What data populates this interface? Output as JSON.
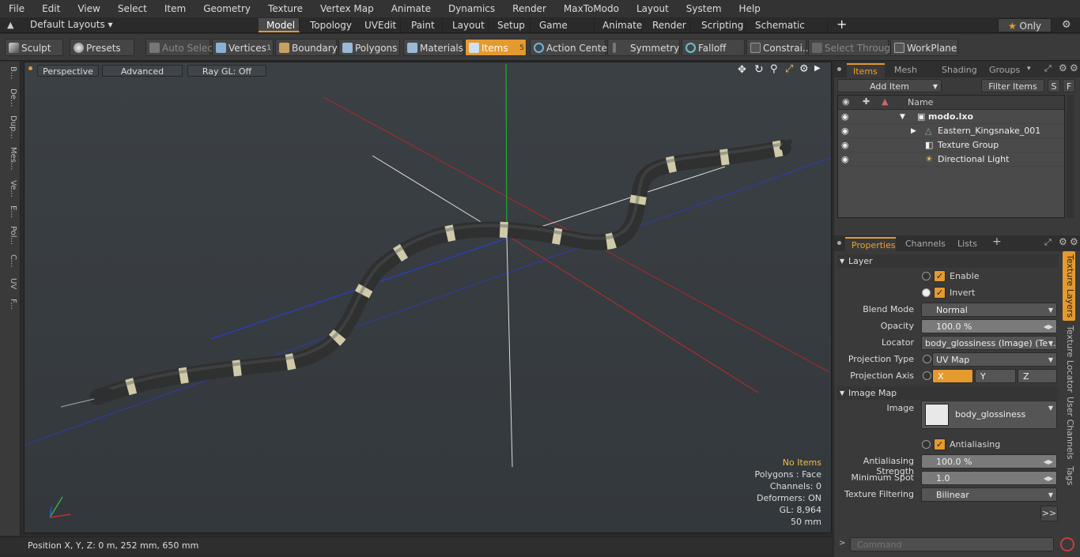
{
  "menu": [
    "File",
    "Edit",
    "View",
    "Select",
    "Item",
    "Geometry",
    "Texture",
    "Vertex Map",
    "Animate",
    "Dynamics",
    "Render",
    "MaxToModo",
    "Layout",
    "System",
    "Help"
  ],
  "layout": {
    "layout_label": "Default Layouts",
    "tabs": [
      "Model",
      "Topology",
      "UVEdit",
      "Paint",
      "Layout",
      "Setup",
      "Game Tools",
      "Animate",
      "Render",
      "Scripting",
      "Schematic Fusion"
    ],
    "active_tab": "Model",
    "add": "+",
    "only_label": "Only"
  },
  "toolbar": {
    "sculpt": "Sculpt",
    "presets": "Presets",
    "auto_select": "Auto Select",
    "vertices": "Vertices",
    "vertices_count": "1",
    "boundary": "Boundary",
    "polygons": "Polygons",
    "materials": "Materials",
    "items": "Items",
    "items_count": "5",
    "action_center": "Action Center",
    "symmetry": "Symmetry",
    "falloff": "Falloff",
    "constraints": "Constrai...",
    "select_through": "Select Through",
    "workplane": "WorkPlane"
  },
  "leftstrip": [
    "B...",
    "De...",
    "Dup...",
    "Mes...",
    "Ve...",
    "E...",
    "Pol...",
    "C...",
    "UV",
    "F..."
  ],
  "viewport": {
    "perspective": "Perspective",
    "advanced": "Advanced",
    "raygl": "Ray GL: Off",
    "info": {
      "no_items": "No Items",
      "polygons": "Polygons : Face",
      "channels": "Channels: 0",
      "deformers": "Deformers: ON",
      "gl": "GL: 8,964",
      "scale": "50 mm"
    }
  },
  "status": {
    "position": "Position X, Y, Z:  0 m, 252 mm, 650 mm"
  },
  "items_panel": {
    "tabs": [
      "Items",
      "Mesh ...",
      "Shading",
      "Groups"
    ],
    "active_tab": "Items",
    "add_item": "Add Item",
    "filter_items": "Filter Items",
    "s_btn": "S",
    "f_btn": "F",
    "name_header": "Name",
    "rows": [
      {
        "name": "modo.lxo"
      },
      {
        "name": "Eastern_Kingsnake_001"
      },
      {
        "name": "Texture Group"
      },
      {
        "name": "Directional Light"
      }
    ]
  },
  "properties": {
    "tabs": [
      "Properties",
      "Channels",
      "Lists"
    ],
    "active_tab": "Properties",
    "add": "+",
    "layer_section": "Layer",
    "enable": "Enable",
    "invert": "Invert",
    "blend_mode_label": "Blend Mode",
    "blend_mode": "Normal",
    "opacity_label": "Opacity",
    "opacity": "100.0 %",
    "locator_label": "Locator",
    "locator": "body_glossiness (Image) (Te ...",
    "projection_type_label": "Projection Type",
    "projection_type": "UV Map",
    "projection_axis_label": "Projection Axis",
    "axis_x": "X",
    "axis_y": "Y",
    "axis_z": "Z",
    "image_map_section": "Image Map",
    "image_label": "Image",
    "image": "body_glossiness",
    "antialiasing": "Antialiasing",
    "aa_strength_label": "Antialiasing Strength",
    "aa_strength": "100.0 %",
    "min_spot_label": "Minimum Spot",
    "min_spot": "1.0",
    "tex_filter_label": "Texture Filtering",
    "tex_filter": "Bilinear",
    "more": ">>",
    "side_tabs": [
      "Texture Layers",
      "Texture Locator",
      "User Channels",
      "Tags"
    ]
  },
  "command": {
    "placeholder": "Command"
  },
  "colors": {
    "accent": "#e49a2e",
    "warn": "#f0c040"
  }
}
